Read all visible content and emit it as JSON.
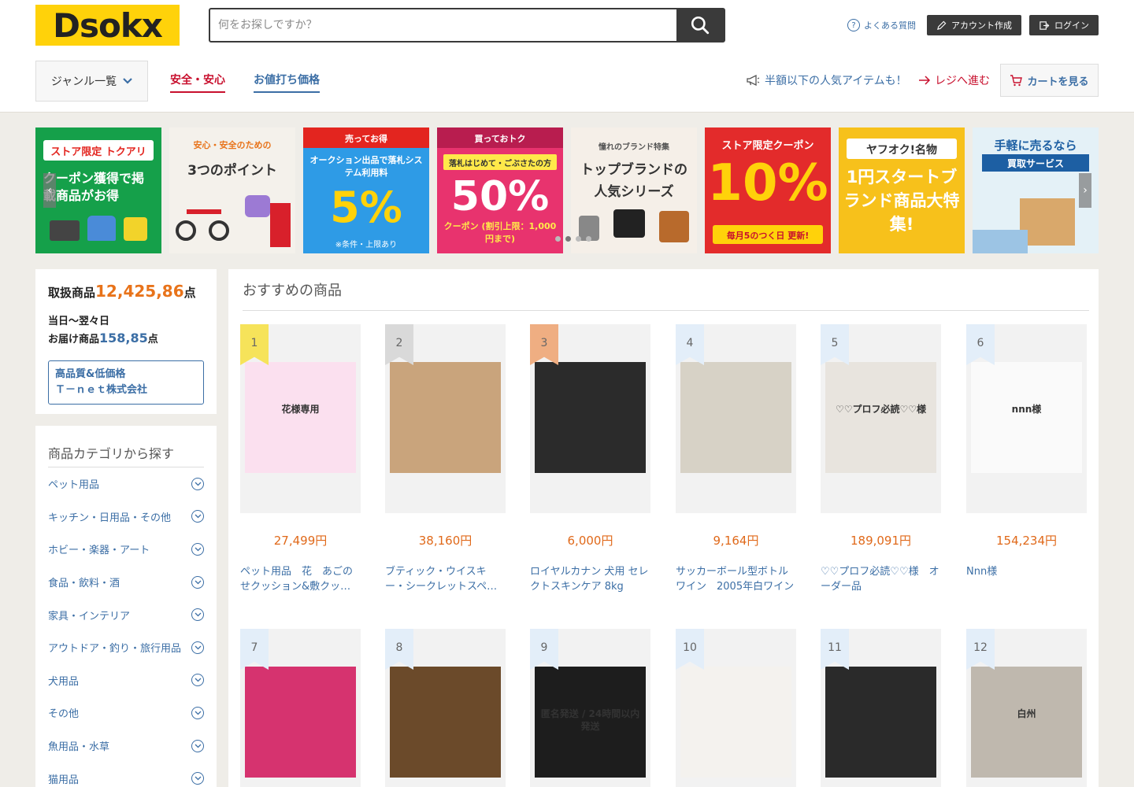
{
  "header": {
    "logo": "Dsokx",
    "search_placeholder": "何をお探しですか？",
    "faq": "よくある質問",
    "register": "アカウント作成",
    "login": "ログイン",
    "genre": "ジャンル一覧",
    "nav_safe": "安全・安心",
    "nav_deal": "お値打ち価格",
    "promo": "半額以下の人気アイテムも！",
    "checkout": "レジへ進む",
    "cart": "カートを見る"
  },
  "banners": [
    {
      "top": "ストア限定 トクアリ",
      "main": "クーポン獲得で掲載商品がお得",
      "color": "#15a04a"
    },
    {
      "top": "安心・安全のための",
      "main": "3つのポイント",
      "color": "#f4f1eb"
    },
    {
      "top": "売ってお得",
      "mid": "オークション出品で落札システム利用料",
      "main": "5%",
      "foot": "※条件・上限あり",
      "color": "#2e9be6"
    },
    {
      "top": "買っておトク",
      "mid": "落札はじめて・ごぶさたの方",
      "main": "50%",
      "foot": "クーポン (割引上限：1,000円まで)",
      "color": "#e8336e"
    },
    {
      "top": "憧れのブランド特集",
      "main": "トップブランドの人気シリーズ",
      "color": "#f5efe8"
    },
    {
      "top": "ストア限定クーポン",
      "main": "10%",
      "foot": "毎月5のつく日 更新!",
      "color": "#e32b2b"
    },
    {
      "top": "ヤフオク!名物",
      "main": "1円スタートブランド商品大特集!",
      "color": "#f7c11b"
    },
    {
      "top": "手軽に売るなら",
      "mid": "買取サービス",
      "color": "#e4f1f7"
    }
  ],
  "stats": {
    "label1": "取扱商品",
    "count1": "12,425,86",
    "unit": "点",
    "label2a": "当日～翌々日",
    "label2b": "お届け商品",
    "count2": "158,85",
    "company1": "高品質&低価格",
    "company2": "Ｔ－ｎｅｔ株式会社"
  },
  "categories": {
    "title": "商品カテゴリから探す",
    "items": [
      "ペット用品",
      "キッチン・日用品・その他",
      "ホビー・楽器・アート",
      "食品・飲料・酒",
      "家具・インテリア",
      "アウトドア・釣り・旅行用品",
      "犬用品",
      "その他",
      "魚用品・水草",
      "猫用品"
    ]
  },
  "main": {
    "title": "おすすめの商品",
    "products": [
      {
        "rank": "1",
        "price": "27,499円",
        "name": "ペット用品　花　あごのせクッション&敷クッション",
        "rank_color": "#f6e35a",
        "img": "#fbe0ef",
        "img_text": "花様専用"
      },
      {
        "rank": "2",
        "price": "38,160円",
        "name": "ブティック・ウイスキー・シークレットスペイサイド",
        "rank_color": "#d9d9d9",
        "img": "#c9a47c"
      },
      {
        "rank": "3",
        "price": "6,000円",
        "name": "ロイヤルカナン 犬用 セレクトスキンケア 8kg",
        "rank_color": "#efae82",
        "img": "#2b2b2b"
      },
      {
        "rank": "4",
        "price": "9,164円",
        "name": "サッカーボール型ボトル ワイン　2005年白ワイン",
        "rank_color": "#e3eef9",
        "img": "#d7d2c6"
      },
      {
        "rank": "5",
        "price": "189,091円",
        "name": "♡♡プロフ必読♡♡様　オーダー品",
        "rank_color": "#e3eef9",
        "img": "#e8e4de",
        "img_text": "♡♡プロフ必読♡♡様"
      },
      {
        "rank": "6",
        "price": "154,234円",
        "name": "Nnn様",
        "rank_color": "#e3eef9",
        "img": "#fafafa",
        "img_text": "nnn様"
      },
      {
        "rank": "7",
        "price": "",
        "name": "",
        "rank_color": "#e3eef9",
        "img": "#d6336f"
      },
      {
        "rank": "8",
        "price": "",
        "name": "",
        "rank_color": "#e3eef9",
        "img": "#6b4a2a"
      },
      {
        "rank": "9",
        "price": "",
        "name": "",
        "rank_color": "#e3eef9",
        "img": "#1d1d1d",
        "img_text": "匿名発送 / 24時間以内発送"
      },
      {
        "rank": "10",
        "price": "",
        "name": "",
        "rank_color": "#e3eef9",
        "img": "#f4f2ee"
      },
      {
        "rank": "11",
        "price": "",
        "name": "",
        "rank_color": "#e3eef9",
        "img": "#2a2a2a"
      },
      {
        "rank": "12",
        "price": "",
        "name": "",
        "rank_color": "#e3eef9",
        "img": "#bfb8ae",
        "img_text": "白州"
      }
    ]
  },
  "colors": {
    "accent_orange": "#e8731a",
    "link_blue": "#3b6ea5",
    "safe_red": "#c8102e",
    "logo_yellow": "#ffd20a"
  }
}
